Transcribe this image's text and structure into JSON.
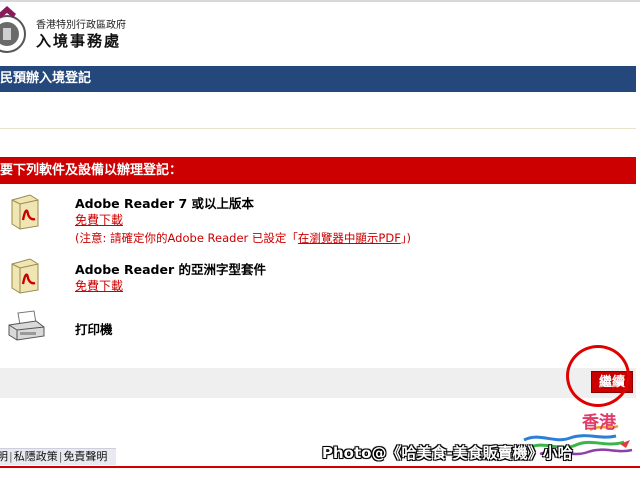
{
  "header": {
    "org_line1": "香港特別行政區政府",
    "org_line2": "入境事務處"
  },
  "title_bar": {
    "label": "居民預辦入境登記"
  },
  "requirements": {
    "heading": "需要下列軟件及設備以辦理登記：",
    "items": [
      {
        "title": "Adobe Reader 7 或以上版本",
        "link": "免費下載",
        "note_prefix": "(注意: 請確定你的Adobe Reader 已設定「",
        "note_link": "在瀏覽器中顯示PDF",
        "note_suffix": "」)"
      },
      {
        "title": "Adobe Reader 的亞洲字型套件",
        "link": "免費下載"
      },
      {
        "title": "打印機"
      }
    ]
  },
  "actions": {
    "continue_label": "繼續"
  },
  "footer": {
    "links": [
      "聲明",
      "私隱政策",
      "免責聲明"
    ]
  },
  "brand": {
    "text": "香港"
  },
  "watermark": {
    "text": "Photo@《哈美食-美食販賣機》小哈"
  },
  "colors": {
    "title_bar": "#24487c",
    "accent_red": "#cc0000",
    "action_bar": "#efefef"
  }
}
